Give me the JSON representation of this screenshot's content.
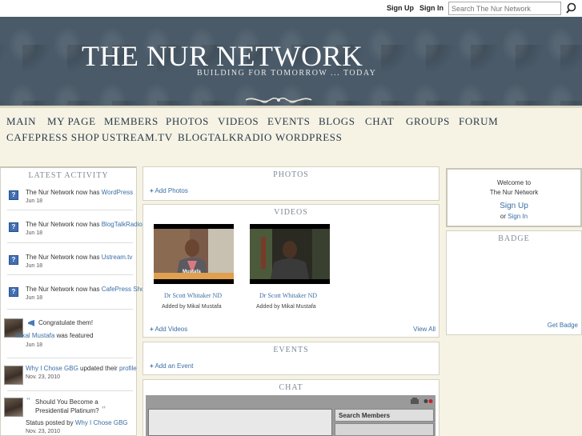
{
  "topbar": {
    "sign_up": "Sign Up",
    "sign_in": "Sign In",
    "search_placeholder": "Search The Nur Network",
    "search_icon": "magnifier-icon"
  },
  "header": {
    "title": "THE NUR NETWORK",
    "tagline": "BUILDING FOR TOMORROW ... TODAY"
  },
  "nav": {
    "items": [
      "MAIN",
      "MY PAGE",
      "MEMBERS",
      "PHOTOS",
      "VIDEOS",
      "EVENTS",
      "BLOGS",
      "CHAT",
      "GROUPS",
      "FORUM",
      "CAFEPRESS SHOP",
      "USTREAM.TV",
      "BLOGTALKRADIO",
      "WORDPRESS"
    ]
  },
  "activity": {
    "title": "LATEST ACTIVITY",
    "items": [
      {
        "prefix": "The Nur Network now has ",
        "link": "WordPress",
        "date": "Jun 18"
      },
      {
        "prefix": "The Nur Network now has ",
        "link": "BlogTalkRadio",
        "date": "Jun 18"
      },
      {
        "prefix": "The Nur Network now has ",
        "link": "Ustream.tv",
        "date": "Jun 18"
      },
      {
        "prefix": "The Nur Network now has ",
        "link": "CafePress Shop",
        "date": "Jun 18"
      }
    ],
    "featured": {
      "headline": "Congratulate them!",
      "user": "Mikal Mustafa",
      "suffix": " was featured",
      "date": "Jun 18"
    },
    "profile_update": {
      "user": "Why I Chose GBG",
      "suffix": " updated their ",
      "link": "profile",
      "date": "Nov. 23, 2010"
    },
    "status": {
      "quote": "Should You Become a Presidential Platinum?",
      "prefix": "Status posted by ",
      "user": "Why I Chose GBG",
      "date": "Nov. 23, 2010"
    }
  },
  "photos": {
    "title": "PHOTOS",
    "add": "Add Photos"
  },
  "videos": {
    "title": "VIDEOS",
    "items": [
      {
        "caption": "Dr Scott Whitaker ND",
        "added_by": "Added by Mikal Mustafa",
        "overlay": "Mustafa"
      },
      {
        "caption": "Dr Scott Whitaker ND",
        "added_by": "Added by Mikal Mustafa"
      }
    ],
    "add": "Add Videos",
    "view_all": "View All"
  },
  "events": {
    "title": "EVENTS",
    "add": "Add an Event"
  },
  "chat": {
    "title": "CHAT",
    "search_members": "Search Members"
  },
  "welcome": {
    "line1": "Welcome to",
    "line2": "The Nur Network",
    "sign_up": "Sign Up",
    "or": "or ",
    "sign_in": "Sign In"
  },
  "badge": {
    "title": "BADGE",
    "get": "Get Badge"
  },
  "colors": {
    "accent": "#3a6ea5",
    "header_bg": "#4a5a68",
    "page_bg": "#f6f3e4"
  }
}
